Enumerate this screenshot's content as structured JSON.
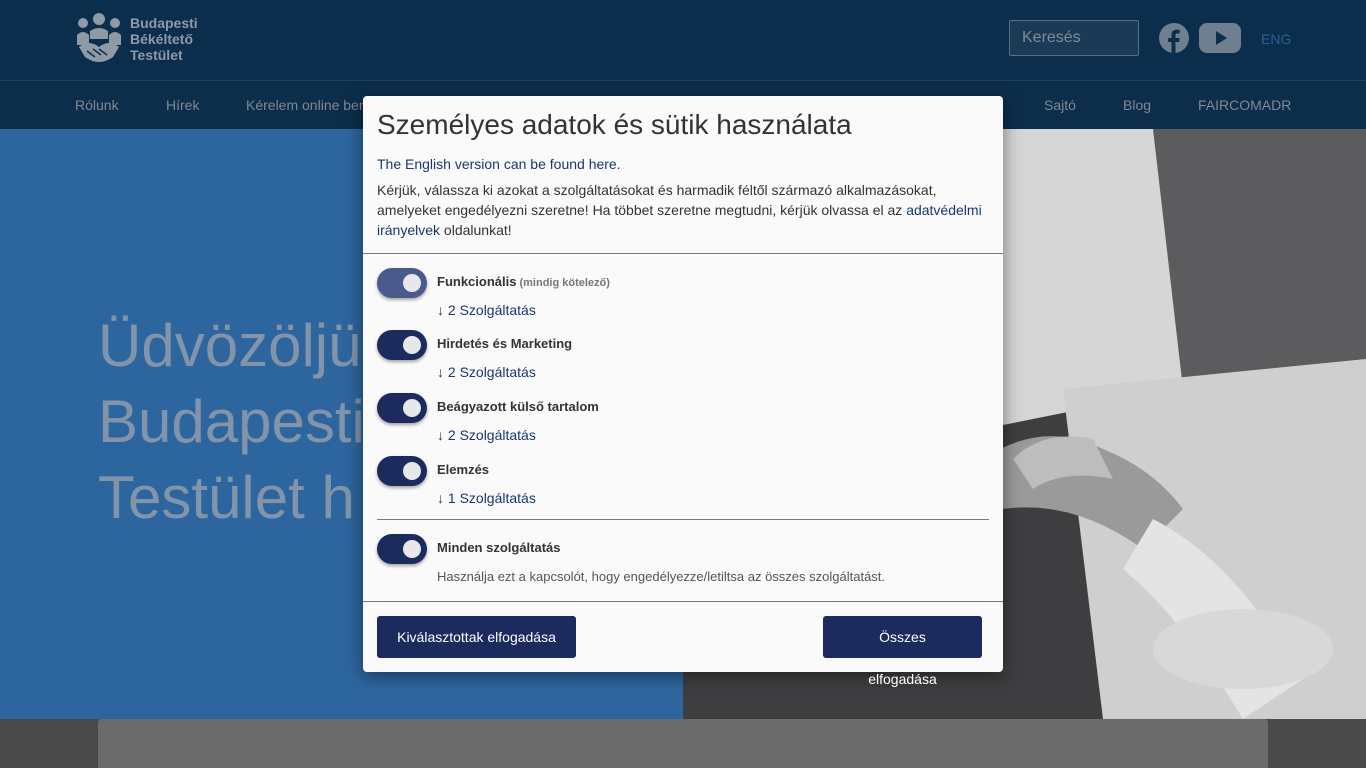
{
  "header": {
    "logo_lines": [
      "Budapesti",
      "Békéltető",
      "Testület"
    ],
    "search_placeholder": "Keresés",
    "lang_link": "ENG",
    "icons": [
      "handshake-people-logo",
      "facebook-icon",
      "youtube-icon"
    ]
  },
  "nav": {
    "items": [
      "Rólunk",
      "Hírek",
      "Kérelem online ben",
      "Sajtó",
      "Blog",
      "FAIRCOMADR"
    ]
  },
  "hero": {
    "title_lines": [
      "Üdvözöljü",
      "Budapesti",
      "Testület h"
    ]
  },
  "modal": {
    "title": "Személyes adatok és sütik használata",
    "english_link": "The English version can be found here.",
    "intro_text": "Kérjük, válassza ki azokat a szolgáltatásokat és harmadik féltől származó alkalmazásokat, amelyeket engedélyezni szeretne! Ha többet szeretne megtudni, kérjük olvassa el az",
    "privacy_link": "adatvédelmi irányelvek",
    "intro_suffix": "oldalunkat!",
    "purposes": [
      {
        "title": "Funkcionális",
        "required_note": "(mindig kötelező)",
        "services": "↓ 2 Szolgáltatás",
        "enabled": true,
        "locked": true
      },
      {
        "title": "Hirdetés és Marketing",
        "required_note": "",
        "services": "↓ 2 Szolgáltatás",
        "enabled": true,
        "locked": false
      },
      {
        "title": "Beágyazott külső tartalom",
        "required_note": "",
        "services": "↓ 2 Szolgáltatás",
        "enabled": true,
        "locked": false
      },
      {
        "title": "Elemzés",
        "required_note": "",
        "services": "↓ 1 Szolgáltatás",
        "enabled": true,
        "locked": false
      }
    ],
    "all_services": {
      "title": "Minden szolgáltatás",
      "description": "Használja ezt a kapcsolót, hogy engedélyezze/letiltsa az összes szolgáltatást.",
      "enabled": true
    },
    "accept_selected": "Kiválasztottak elfogadása",
    "accept_all": "Összes elfogadása"
  },
  "colors": {
    "header_bg": "#0b2e4c",
    "hero_blue": "#2d669f",
    "primary_button": "#1b2b5e",
    "link": "#1b3670"
  }
}
